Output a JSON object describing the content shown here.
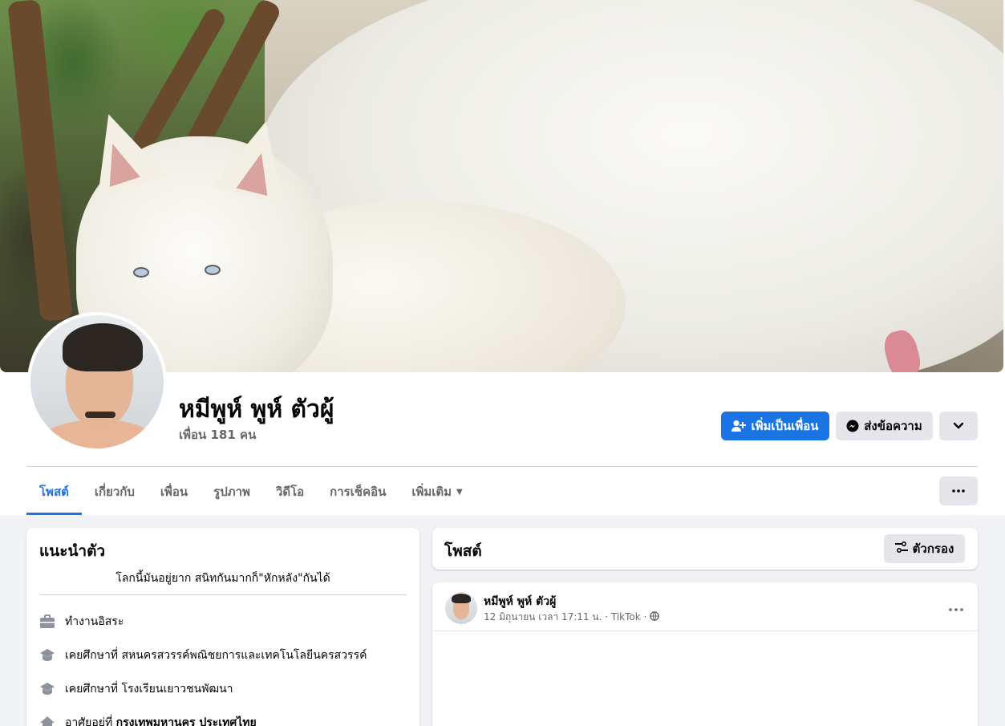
{
  "profile": {
    "name": "หมีพูห์ พูห์ ตัวผู้",
    "friends": "เพื่อน 181 คน"
  },
  "actions": {
    "add_friend": "เพิ่มเป็นเพื่อน",
    "message": "ส่งข้อความ"
  },
  "tabs": [
    {
      "label": "โพสต์",
      "active": true
    },
    {
      "label": "เกี่ยวกับ"
    },
    {
      "label": "เพื่อน"
    },
    {
      "label": "รูปภาพ"
    },
    {
      "label": "วิดีโอ"
    },
    {
      "label": "การเช็คอิน"
    },
    {
      "label": "เพิ่มเติม"
    }
  ],
  "intro": {
    "title": "แนะนำตัว",
    "bio": "โลกนี้มันอยู่ยาก สนิทกันมากก็\"หักหลัง\"กันได้",
    "items": [
      {
        "icon": "briefcase-icon",
        "text": "ทำงานอิสระ"
      },
      {
        "icon": "graduation-cap-icon",
        "text": "เคยศึกษาที่ สหนครสวรรค์พณิชยการและเทคโนโลยีนครสวรรค์"
      },
      {
        "icon": "graduation-cap-icon",
        "text": "เคยศึกษาที่ โรงเรียนเยาวชนพัฒนา"
      },
      {
        "icon": "home-icon",
        "prefix": "อาศัยอยู่ที่ ",
        "place": "กรุงเทพมหานคร ประเทศไทย"
      }
    ]
  },
  "posts": {
    "title": "โพสต์",
    "filter_label": "ตัวกรอง",
    "first": {
      "author": "หมีพูห์ พูห์ ตัวผู้",
      "meta": "12 มิถุนายน เวลา 17:11 น. · TikTok ·",
      "privacy_icon": "globe-icon"
    }
  },
  "colors": {
    "accent": "#1b74e4",
    "background": "#f0f2f5",
    "button_gray": "#e4e6eb",
    "secondary_text": "#65676b"
  }
}
